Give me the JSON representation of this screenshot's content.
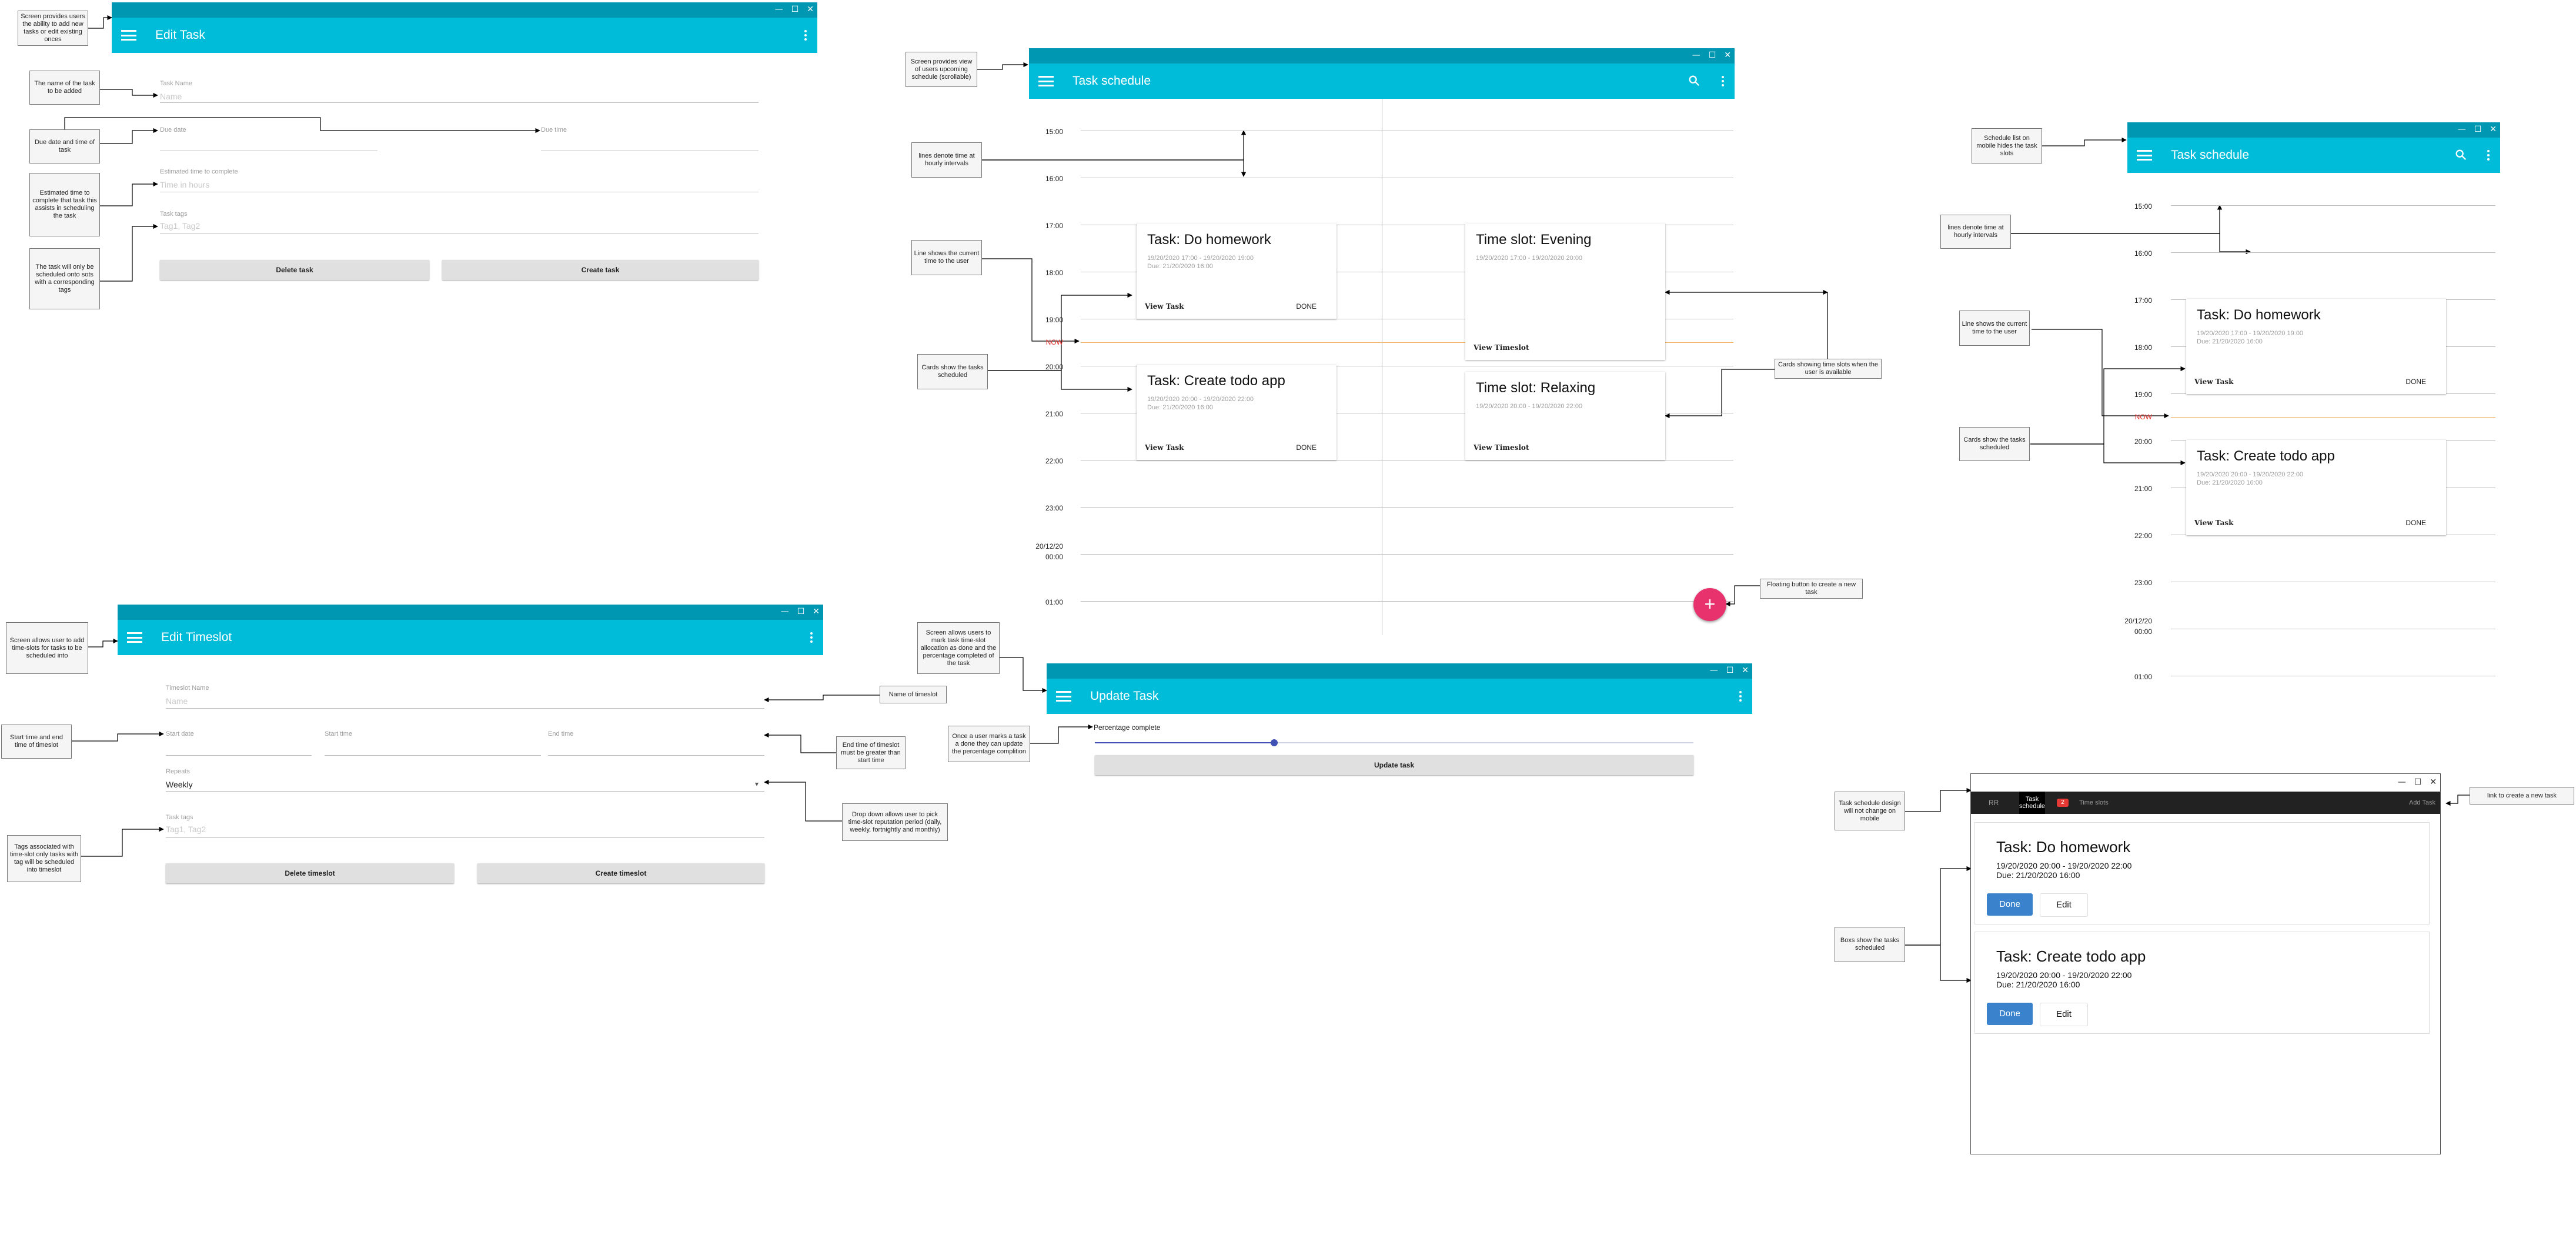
{
  "colors": {
    "titlebar": "#0097b2",
    "appbar": "#00bcd9",
    "fab": "#e8326e",
    "now_line": "#f0b060",
    "now_text": "#e53935",
    "slider": "#3f51b5",
    "done_button": "#3a82cc",
    "mobile_bar": "#222222",
    "badge": "#e53935"
  },
  "window_controls": {
    "minimize": "—",
    "maximize": "☐",
    "close": "✕"
  },
  "edit_task": {
    "title": "Edit Task",
    "task_name_label": "Task Name",
    "task_name_placeholder": "Name",
    "due_date_label": "Due date",
    "due_time_label": "Due time",
    "estimate_label": "Estimated time to complete",
    "estimate_placeholder": "Time in hours",
    "tags_label": "Task tags",
    "tags_placeholder": "Tag1, Tag2",
    "delete_button": "Delete task",
    "create_button": "Create task"
  },
  "edit_timeslot": {
    "title": "Edit Timeslot",
    "name_label": "Timeslot Name",
    "name_placeholder": "Name",
    "start_date_label": "Start date",
    "start_time_label": "Start time",
    "end_time_label": "End time",
    "repeats_label": "Repeats",
    "repeats_value": "Weekly",
    "tags_label": "Task tags",
    "tags_placeholder": "Tag1, Tag2",
    "delete_button": "Delete timeslot",
    "create_button": "Create timeslot"
  },
  "update_task": {
    "title": "Update Task",
    "slider_label": "Percentage complete",
    "percent_complete": 0.3,
    "update_button": "Update task"
  },
  "schedule_desktop": {
    "title": "Task schedule",
    "times": [
      "15:00",
      "16:00",
      "17:00",
      "18:00",
      "19:00",
      "NOW",
      "20:00",
      "21:00",
      "22:00",
      "23:00",
      "20/12/20\n00:00",
      "01:00"
    ],
    "cards": [
      {
        "title": "Task: Do homework",
        "line1": "19/20/2020 17:00 - 19/20/2020 19:00",
        "line2": "Due: 21/20/2020 16:00",
        "action": "View Task",
        "done": "DONE"
      },
      {
        "title": "Time slot: Evening",
        "line1": "19/20/2020 17:00 - 19/20/2020 20:00",
        "line2": "",
        "action": "View Timeslot",
        "done": ""
      },
      {
        "title": "Task: Create todo app",
        "line1": "19/20/2020 20:00 - 19/20/2020 22:00",
        "line2": "Due: 21/20/2020 16:00",
        "action": "View Task",
        "done": "DONE"
      },
      {
        "title": "Time slot: Relaxing",
        "line1": "19/20/2020 20:00 - 19/20/2020 22:00",
        "line2": "",
        "action": "View Timeslot",
        "done": ""
      }
    ],
    "fab": "+"
  },
  "schedule_mobile": {
    "title": "Task schedule",
    "times": [
      "15:00",
      "16:00",
      "17:00",
      "18:00",
      "19:00",
      "NOW",
      "20:00",
      "21:00",
      "22:00",
      "23:00",
      "20/12/20\n00:00",
      "01:00"
    ],
    "cards": [
      {
        "title": "Task: Do homework",
        "line1": "19/20/2020 17:00 - 19/20/2020 19:00",
        "line2": "Due: 21/20/2020 16:00",
        "action": "View Task",
        "done": "DONE"
      },
      {
        "title": "Task: Create todo app",
        "line1": "19/20/2020 20:00 - 19/20/2020 22:00",
        "line2": "Due: 21/20/2020 16:00",
        "action": "View Task",
        "done": "DONE"
      }
    ]
  },
  "schedule_web": {
    "nav": {
      "brand": "RR",
      "tab_active": "Task schedule",
      "badge": "2",
      "tab2": "Time slots",
      "add": "Add Task"
    },
    "boxes": [
      {
        "title": "Task: Do homework",
        "line1": "19/20/2020 20:00 - 19/20/2020 22:00",
        "line2": "Due: 21/20/2020 16:00",
        "done": "Done",
        "edit": "Edit"
      },
      {
        "title": "Task: Create todo app",
        "line1": "19/20/2020 20:00 - 19/20/2020 22:00",
        "line2": "Due: 21/20/2020 16:00",
        "done": "Done",
        "edit": "Edit"
      }
    ]
  },
  "annotations": {
    "a1": "Screen provides users the ability to add new tasks or edit existing onces",
    "a2": "The name of the task to be added",
    "a3": "Due date and time of task",
    "a4": "Estimated time to complete that task this assists in scheduling the task",
    "a5": "The task will only be scheduled onto sots with a corresponding tags",
    "a6": "Screen provides view of users upcoming schedule (scrollable)",
    "a7": "lines denote time at hourly intervals",
    "a8": "Line shows the current time to the user",
    "a9": "Cards show the tasks scheduled",
    "a10": "Cards showing time slots when the user is available",
    "a11": "Floating button to create a new task",
    "a12": "Schedule list on mobile hides the task slots",
    "a13": "lines denote time at hourly intervals",
    "a14": "Line shows the current time to the user",
    "a15": "Cards show the tasks scheduled",
    "a16": "Screen allows user to add time-slots for tasks to be scheduled into",
    "a17": "Start time and end time of timeslot",
    "a18": "Tags associated with time-slot only tasks with tag will be scheduled into timeslot",
    "a19": "Name of timeslot",
    "a20": "End time of timeslot must be greater than start time",
    "a21": "Drop down allows user to pick time-slot reputation period (daily, weekly, fortnightly and monthly)",
    "a22": "Screen allows users to mark task time-slot allocation as done and the percentage completed of the task",
    "a23": "Once a user marks a task a done they can update the percentage complition",
    "a24": "Task schedule design will not change on mobile",
    "a25": "Boxs show the tasks scheduled",
    "a26": "link to create a new task"
  }
}
